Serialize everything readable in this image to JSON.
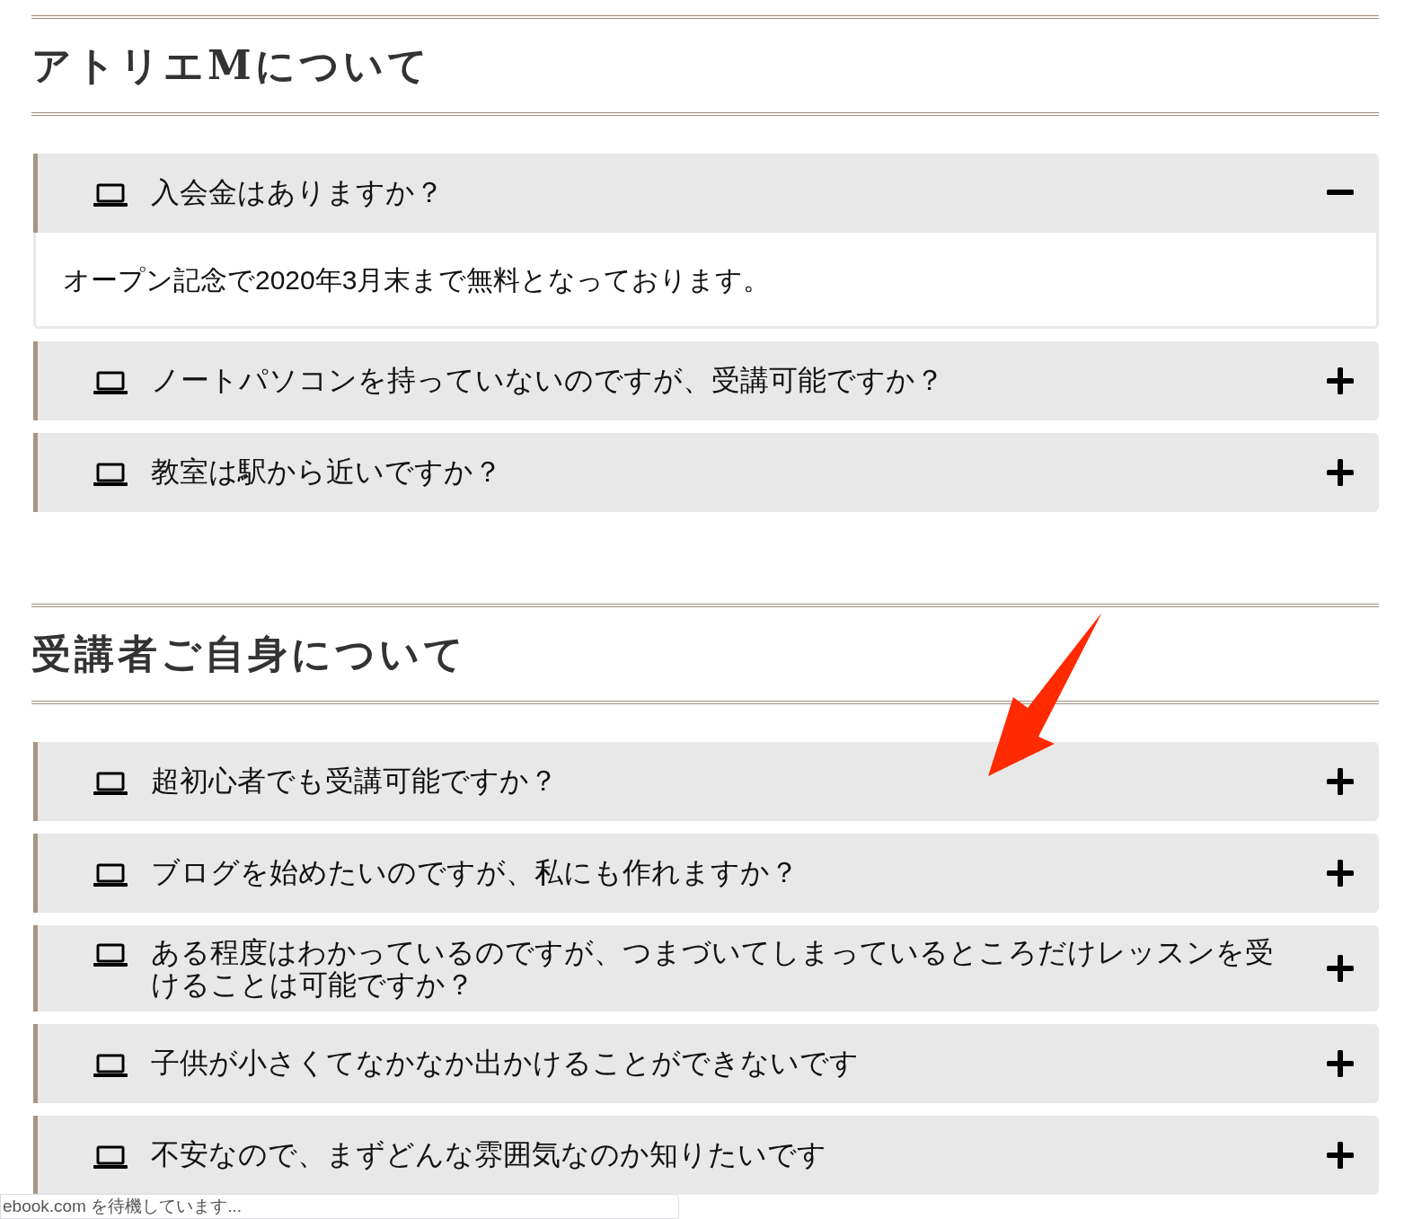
{
  "sections": [
    {
      "heading": "アトリエMについて",
      "items": [
        {
          "question": "入会金はありますか？",
          "expanded": true,
          "answer": "オープン記念で2020年3月末まで無料となっております。"
        },
        {
          "question": "ノートパソコンを持っていないのですが、受講可能ですか？",
          "expanded": false
        },
        {
          "question": "教室は駅から近いですか？",
          "expanded": false
        }
      ]
    },
    {
      "heading": "受講者ご自身について",
      "items": [
        {
          "question": "超初心者でも受講可能ですか？",
          "expanded": false
        },
        {
          "question": "ブログを始めたいのですが、私にも作れますか？",
          "expanded": false
        },
        {
          "question": "ある程度はわかっているのですが、つまづいてしまっているところだけレッスンを受けることは可能ですか？",
          "expanded": false
        },
        {
          "question": "子供が小さくてなかなか出かけることができないです",
          "expanded": false
        },
        {
          "question": "不安なので、まずどんな雰囲気なのか知りたいです",
          "expanded": false
        }
      ]
    }
  ],
  "status_bar": {
    "text": "ebook.com を待機しています..."
  }
}
